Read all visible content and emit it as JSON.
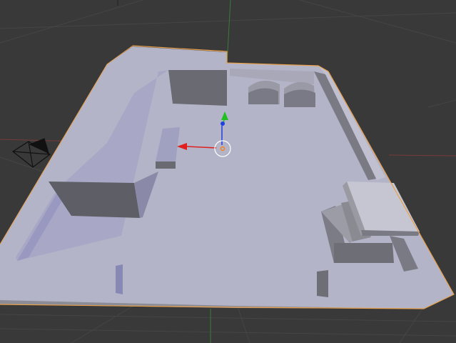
{
  "viewport": {
    "background": "#393939",
    "grid_color": "#454545",
    "x_axis_color": "#7a3a3a",
    "y_axis_color": "#3c7a3c"
  },
  "model": {
    "selected_outline": "#e8a04c",
    "face_top": "#b4b4c8",
    "face_lit": "#a8a8c6",
    "face_dark": "#6a6a72",
    "face_mid": "#868690"
  },
  "gizmo": {
    "x_arrow_color": "#e02020",
    "y_arrow_color": "#20c020",
    "z_arrow_color": "#2040e0",
    "center_ring_color": "#ffffff",
    "origin_color": "#ff7a00"
  },
  "icons": {
    "camera": "camera-icon",
    "transform_gizmo": "translate-gizmo-icon",
    "object_origin": "object-origin-icon"
  }
}
